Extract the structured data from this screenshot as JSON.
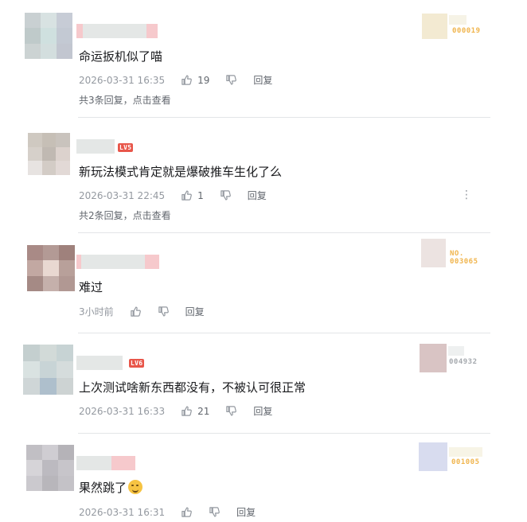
{
  "icons": {
    "like": "thumb-up-icon",
    "dislike": "thumb-down-icon",
    "more": "more-vertical-icon"
  },
  "comments": [
    {
      "text": "命运扳机似了喵",
      "time": "2026-03-31 16:35",
      "likes": "19",
      "reply_label": "回复",
      "replies_summary": "共3条回复，点击查看",
      "badge_no": "000019",
      "level": ""
    },
    {
      "text": "新玩法模式肯定就是爆破推车生化了么",
      "time": "2026-03-31 22:45",
      "likes": "1",
      "reply_label": "回复",
      "replies_summary": "共2条回复，点击查看",
      "badge_no": "",
      "level": "LV5"
    },
    {
      "text": "难过",
      "time": "3小时前",
      "likes": "",
      "reply_label": "回复",
      "replies_summary": "",
      "badge_prefix": "NO.",
      "badge_no": "003065",
      "level": ""
    },
    {
      "text": "上次测试啥新东西都没有，不被认可很正常",
      "time": "2026-03-31 16:33",
      "likes": "21",
      "reply_label": "回复",
      "replies_summary": "",
      "badge_no": "004932",
      "level": "LV6"
    },
    {
      "text": "果然跳了",
      "time": "2026-03-31 16:31",
      "likes": "",
      "reply_label": "回复",
      "replies_summary": "",
      "badge_no": "001005",
      "level": ""
    }
  ]
}
